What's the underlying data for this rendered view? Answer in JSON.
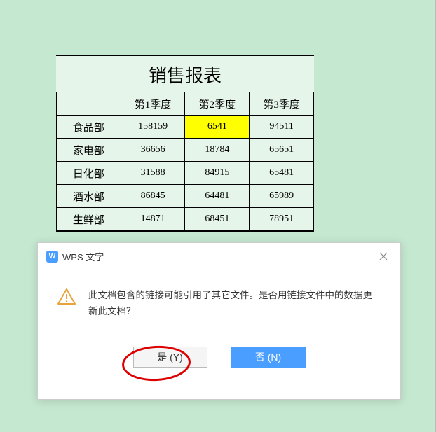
{
  "table": {
    "title": "销售报表",
    "headers": [
      "",
      "第1季度",
      "第2季度",
      "第3季度"
    ],
    "rows": [
      {
        "label": "食品部",
        "q1": "158159",
        "q2": "6541",
        "q3": "94511",
        "highlight": "q2"
      },
      {
        "label": "家电部",
        "q1": "36656",
        "q2": "18784",
        "q3": "65651"
      },
      {
        "label": "日化部",
        "q1": "31588",
        "q2": "84915",
        "q3": "65481"
      },
      {
        "label": "酒水部",
        "q1": "86845",
        "q2": "64481",
        "q3": "65989"
      },
      {
        "label": "生鲜部",
        "q1": "14871",
        "q2": "68451",
        "q3": "78951"
      }
    ]
  },
  "dialog": {
    "logo_text": "W",
    "title": "WPS 文字",
    "message": "此文档包含的链接可能引用了其它文件。是否用链接文件中的数据更新此文档？",
    "yes_label": "是 (Y)",
    "no_label": "否 (N)"
  }
}
